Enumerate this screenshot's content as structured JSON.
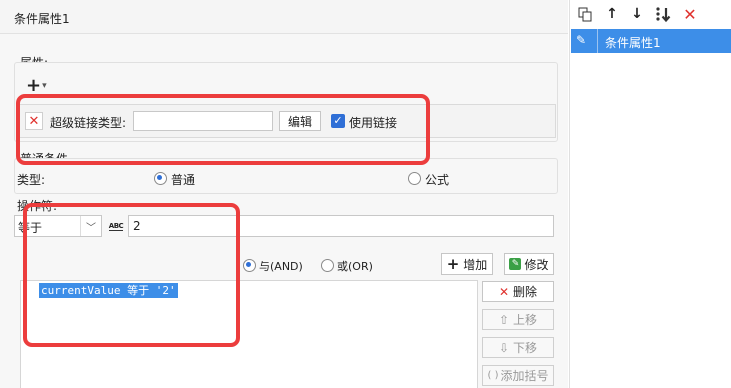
{
  "dialog": {
    "title": "条件属性1"
  },
  "properties": {
    "section_label": "属性:",
    "add_symbol": "+",
    "dropdown_arrow": "▾",
    "delete_symbol": "✕",
    "hyperlink_type_label": "超级链接类型:",
    "hyperlink_value": "",
    "edit_button": "编辑",
    "use_link_label": "使用链接",
    "use_link_checked": true
  },
  "common": {
    "section_label": "普通条件",
    "type_label": "类型:",
    "type_normal": "普通",
    "type_formula": "公式",
    "operator_label": "操作符:",
    "operator_value": "等于",
    "chevron": "﹀",
    "abc_label": "ABC",
    "value": "2"
  },
  "logic": {
    "and_label": "与(AND)",
    "or_label": "或(OR)",
    "add_button": "增加",
    "modify_button": "修改"
  },
  "condition_list": {
    "items": [
      "currentValue 等于 '2'"
    ]
  },
  "side_buttons": {
    "delete": "删除",
    "move_up": "上移",
    "move_down": "下移",
    "add_brackets": "添加括号"
  },
  "right_panel": {
    "toolbar_icons": [
      "copy-icon",
      "arrow-up-icon",
      "arrow-down-icon",
      "sort-down-icon",
      "delete-icon"
    ],
    "selected_item": "条件属性1"
  },
  "colors": {
    "highlight_red": "#ec3d3d",
    "selection_blue": "#3d8ee8",
    "checkbox_blue": "#2f6fd6"
  }
}
